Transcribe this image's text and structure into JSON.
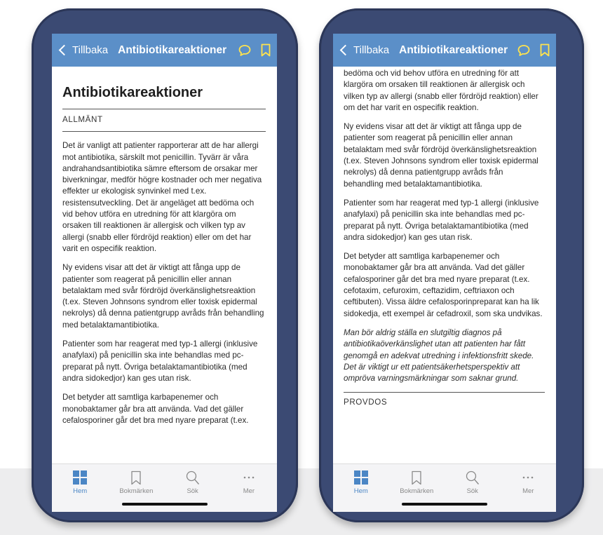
{
  "nav": {
    "back_label": "Tillbaka",
    "title": "Antibiotikareaktioner",
    "accent": "#5b8fc8",
    "icons": [
      "comment-icon",
      "bookmark-icon"
    ]
  },
  "tabs": [
    {
      "label": "Hem",
      "icon": "grid-icon",
      "active": true
    },
    {
      "label": "Bokmärken",
      "icon": "bookmark-icon",
      "active": false
    },
    {
      "label": "Sök",
      "icon": "search-icon",
      "active": false
    },
    {
      "label": "Mer",
      "icon": "more-icon",
      "active": false
    }
  ],
  "screen1": {
    "heading": "Antibiotikareaktioner",
    "section": "ALLMÄNT",
    "paragraphs": [
      "Det är vanligt att patienter rapporterar att de har allergi mot antibiotika, särskilt mot penicillin. Tyvärr är våra andrahandsantibiotika sämre eftersom de orsakar mer biverkningar, medför högre kostnader och mer negativa effekter ur ekologisk synvinkel med t.ex. resistensutveckling. Det är angeläget att bedöma och vid behov utföra en utredning för att klargöra om orsaken till reaktionen är allergisk och vilken typ av allergi (snabb eller fördröjd reaktion) eller om det har varit en ospecifik reaktion.",
      "Ny evidens visar att det är viktigt att fånga upp de patienter som reagerat på penicillin eller annan betalaktam med svår fördröjd överkänslighetsreaktion (t.ex. Steven Johnsons syndrom eller toxisk epidermal nekrolys) då denna patientgrupp avråds från behandling med betalaktamantibiotika.",
      "Patienter som har reagerat med typ-1 allergi (inklusive anafylaxi) på penicillin ska inte behandlas med pc-preparat på nytt. Övriga betalaktamantibiotika (med andra sidokedjor) kan ges utan risk.",
      "Det betyder att samtliga karbapenemer och monobaktamer går bra att använda. Vad det gäller cefalosporiner går det bra med nyare preparat (t.ex."
    ]
  },
  "screen2": {
    "paragraphs": [
      "bedöma och vid behov utföra en utredning för att klargöra om orsaken till reaktionen är allergisk och vilken typ av allergi (snabb eller fördröjd reaktion) eller om det har varit en ospecifik reaktion.",
      "Ny evidens visar att det är viktigt att fånga upp de patienter som reagerat på penicillin eller annan betalaktam med svår fördröjd överkänslighetsreaktion (t.ex. Steven Johnsons syndrom eller toxisk epidermal nekrolys) då denna patientgrupp avråds från behandling med betalaktamantibiotika.",
      "Patienter som har reagerat med typ-1 allergi (inklusive anafylaxi) på penicillin ska inte behandlas med pc-preparat på nytt. Övriga betalaktamantibiotika (med andra sidokedjor) kan ges utan risk.",
      "Det betyder att samtliga karbapenemer och monobaktamer går bra att använda. Vad det gäller cefalosporiner går det bra med nyare preparat (t.ex. cefotaxim, cefuroxim, ceftazidim, ceftriaxon och ceftibuten). Vissa äldre cefalosporinpreparat kan ha lik sidokedja, ett exempel är cefadroxil, som ska undvikas."
    ],
    "italic_note": "Man bör aldrig ställa en slutgiltig diagnos på antibiotikaöverkänslighet utan att patienten har fått genomgå en adekvat utredning i infektionsfritt skede. Det är viktigt ur ett patientsäkerhetsperspektiv att ompröva varningsmärkningar som saknar grund.",
    "section": "PROVDOS"
  }
}
